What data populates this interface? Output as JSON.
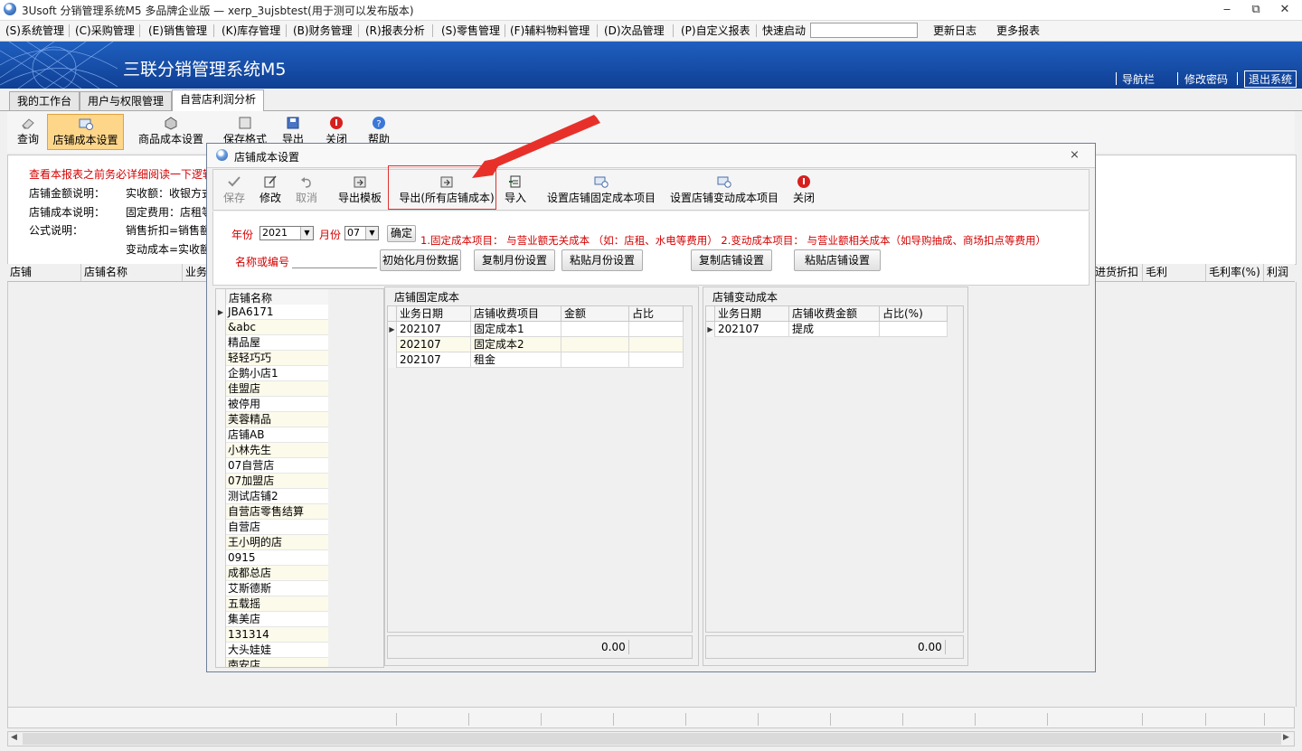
{
  "window": {
    "title": "3Usoft 分销管理系统M5 多品牌企业版 — xerp_3ujsbtest(用于测可以发布版本)",
    "controls": [
      "‒",
      "⧉",
      "✕"
    ]
  },
  "menu": {
    "items": [
      "(S)系统管理",
      "(C)采购管理",
      "(E)销售管理",
      "(K)库存管理",
      "(B)财务管理",
      "(R)报表分析",
      "(S)零售管理",
      "(F)辅料物料管理",
      "(D)次品管理",
      "(P)自定义报表"
    ],
    "quick_label": "快速启动",
    "quick_value": "",
    "extra": [
      "更新日志",
      "更多报表"
    ]
  },
  "banner": {
    "brand": "三联分销管理系统M5",
    "links": [
      "导航栏",
      "修改密码",
      "退出系统"
    ],
    "bg_color": "#1a55b3"
  },
  "tabs": [
    "我的工作台",
    "用户与权限管理",
    "自营店利润分析"
  ],
  "toolbar": {
    "buttons": [
      {
        "label": "查询",
        "icon": "eraser-icon"
      },
      {
        "label": "店铺成本设置",
        "icon": "store-cost-icon"
      },
      {
        "label": "商品成本设置",
        "icon": "goods-cost-icon"
      },
      {
        "label": "保存格式",
        "icon": "save-format-icon"
      },
      {
        "label": "导出",
        "icon": "export-icon"
      },
      {
        "label": "关闭",
        "icon": "close-icon"
      },
      {
        "label": "帮助",
        "icon": "help-icon"
      }
    ]
  },
  "notes": {
    "warning": "查看本报表之前务必详细阅读一下逻辑",
    "label1": "店铺金额说明：",
    "text1": "实收额：收银方式",
    "label2": "店铺成本说明：",
    "text2": "固定费用：店租等",
    "label3": "公式说明：",
    "text3": "销售折扣=销售额",
    "text4": "变动成本=实收额"
  },
  "report_grid": {
    "headers_left": [
      "店铺",
      "店铺名称",
      "业务"
    ],
    "headers_right": [
      "进货折扣",
      "毛利",
      "毛利率(%)",
      "利润"
    ]
  },
  "dialog": {
    "title": "店铺成本设置",
    "close": "⨯",
    "toolbar": [
      {
        "label": "保存",
        "enabled": false
      },
      {
        "label": "修改",
        "enabled": true
      },
      {
        "label": "取消",
        "enabled": false
      },
      {
        "label": "导出模板",
        "enabled": true
      },
      {
        "label": "导出(所有店铺成本)",
        "enabled": true
      },
      {
        "label": "导入",
        "enabled": true
      },
      {
        "label": "设置店铺固定成本项目",
        "enabled": true
      },
      {
        "label": "设置店铺变动成本项目",
        "enabled": true
      },
      {
        "label": "关闭",
        "enabled": true
      }
    ],
    "year_label": "年份",
    "year_value": "2021",
    "month_label": "月份",
    "month_value": "07",
    "confirm": "确定",
    "hint": "1.固定成本项目： 与营业额无关成本 （如：店租、水电等费用） 2.变动成本项目： 与营业额相关成本（如导购抽成、商场扣点等费用）",
    "name_label": "名称或编号",
    "name_value": "",
    "buttons": [
      "初始化月份数据",
      "复制月份设置",
      "粘贴月份设置",
      "复制店铺设置",
      "粘贴店铺设置"
    ],
    "store_list": {
      "header": "店铺名称",
      "items": [
        "JBA6171",
        "&abc",
        "精品屋",
        "轻轻巧巧",
        "企鹅小店1",
        "佳盟店",
        "被停用",
        "芙蓉精品",
        "店铺AB",
        "小林先生",
        "07自营店",
        "07加盟店",
        "测试店铺2",
        "自营店零售结算",
        "自营店",
        "王小明的店",
        "0915",
        "成都总店",
        "艾斯德斯",
        "五载摇",
        "集美店",
        "131314",
        "大头娃娃",
        "南安店"
      ]
    },
    "fixed_cost": {
      "title": "店铺固定成本",
      "headers": [
        "业务日期",
        "店铺收费项目",
        "金额",
        "占比"
      ],
      "rows": [
        [
          "202107",
          "固定成本1",
          "",
          ""
        ],
        [
          "202107",
          "固定成本2",
          "",
          ""
        ],
        [
          "202107",
          "租金",
          "",
          ""
        ]
      ],
      "total": "0.00"
    },
    "variable_cost": {
      "title": "店铺变动成本",
      "headers": [
        "业务日期",
        "店铺收费金额",
        "占比(%)"
      ],
      "rows": [
        [
          "202107",
          "提成",
          ""
        ]
      ],
      "total": "0.00"
    }
  }
}
